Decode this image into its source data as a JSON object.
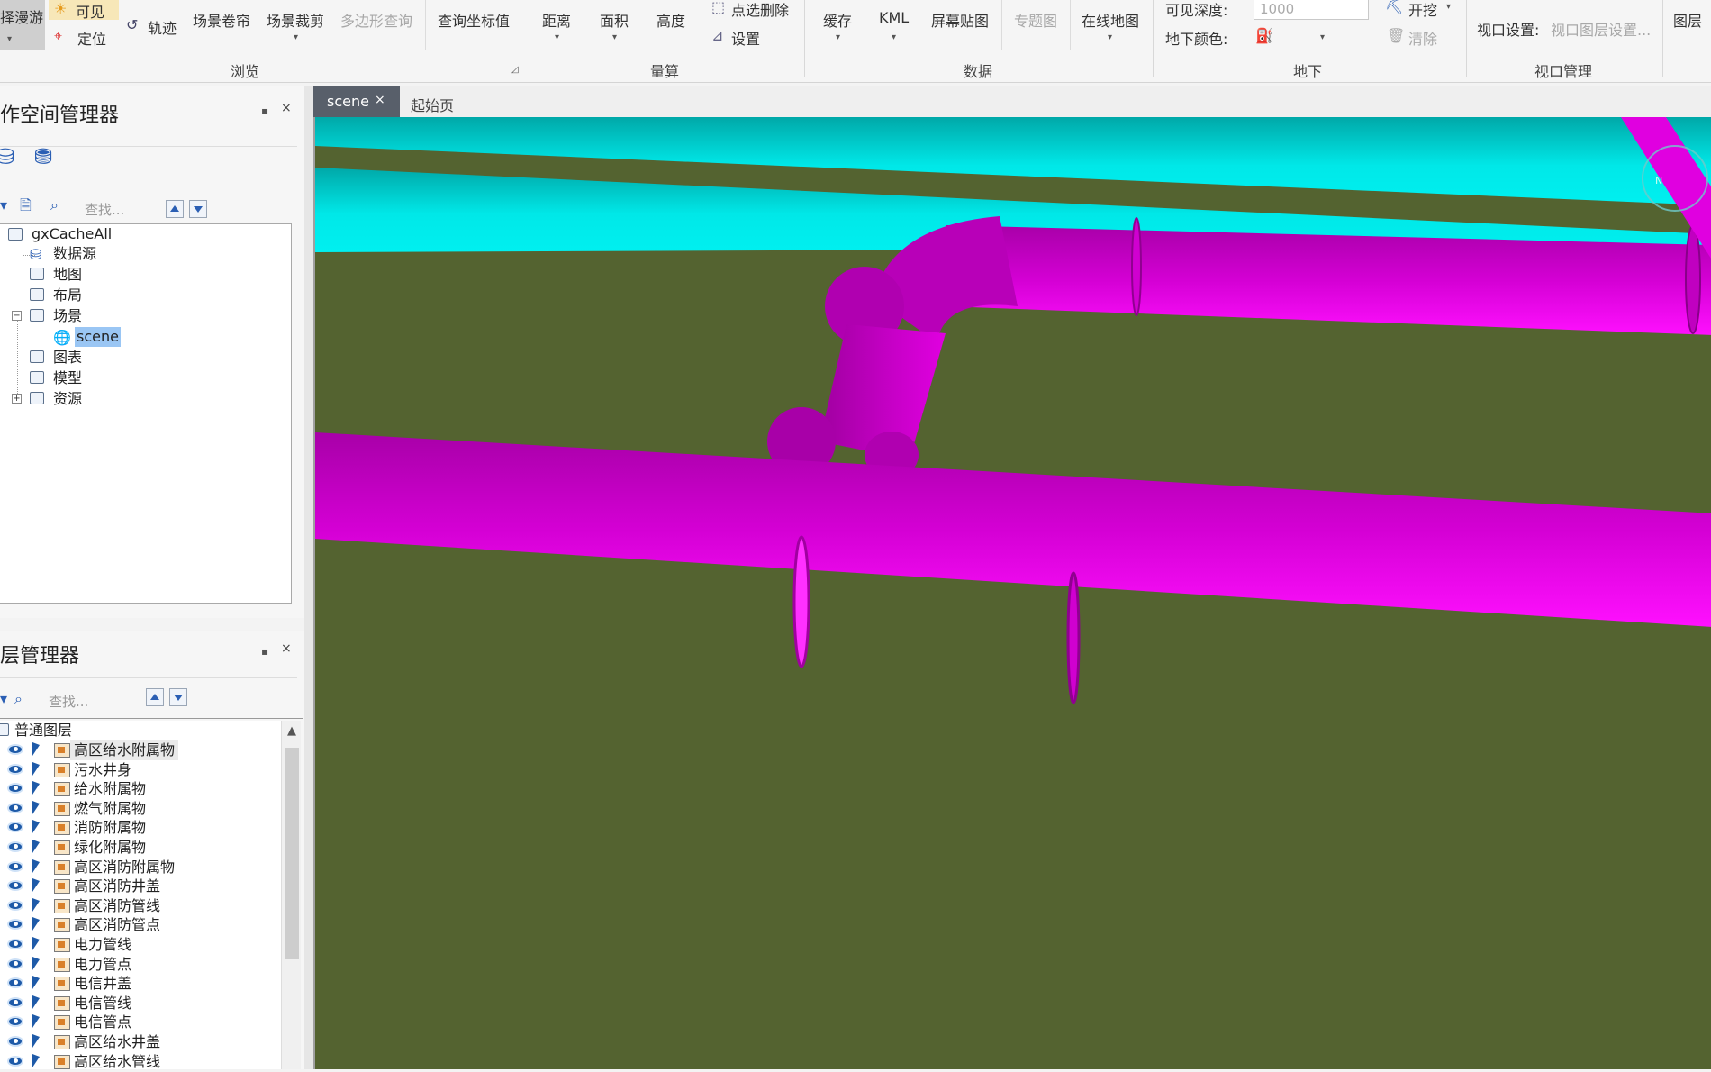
{
  "ribbon": {
    "browse": {
      "roam": "择漫游",
      "visible": "可见",
      "locate": "定位",
      "track": "轨迹",
      "scene_roll": "场景卷帘",
      "scene_clip": "场景裁剪",
      "polygon_query": "多边形查询",
      "group": "浏览"
    },
    "query": {
      "query_coord": "查询坐标值"
    },
    "measure": {
      "distance": "距离",
      "area": "面积",
      "height": "高度",
      "point_delete": "点选删除",
      "settings": "设置",
      "group": "量算"
    },
    "data": {
      "cache": "缓存",
      "kml": "KML",
      "screen_map": "屏幕贴图",
      "thematic": "专题图",
      "online_map": "在线地图",
      "group": "数据"
    },
    "underground": {
      "visible_depth_label": "可见深度:",
      "visible_depth_value": "1000",
      "under_color_label": "地下颜色:",
      "dig": "开挖",
      "clear": "清除",
      "group": "地下"
    },
    "viewport": {
      "settings_label": "视口设置:",
      "settings_value": "视口图层设置...",
      "group": "视口管理",
      "layer_cut": "图层"
    }
  },
  "workspace": {
    "title": "作空间管理器",
    "search_placeholder": "查找...",
    "root": "gxCacheAll",
    "nodes": [
      "数据源",
      "地图",
      "布局",
      "场景",
      "scene",
      "图表",
      "模型",
      "资源"
    ]
  },
  "layers": {
    "title": "层管理器",
    "search_placeholder": "查找...",
    "group": "普通图层",
    "items": [
      "高区给水附属物",
      "污水井身",
      "给水附属物",
      "燃气附属物",
      "消防附属物",
      "绿化附属物",
      "高区消防附属物",
      "高区消防井盖",
      "高区消防管线",
      "高区消防管点",
      "电力管线",
      "电力管点",
      "电信井盖",
      "电信管线",
      "电信管点",
      "高区给水井盖",
      "高区给水管线"
    ]
  },
  "tabs": {
    "active": "scene",
    "close": "×",
    "inactive": "起始页"
  },
  "controls": {
    "pin": "▪",
    "close": "×",
    "collapse": "−",
    "expand": "+"
  },
  "colors": {
    "ground": "#546330",
    "pipe_cyan": "#00e6e6",
    "pipe_magenta": "#e600e6",
    "pipe_red": "#ff1a1a"
  }
}
